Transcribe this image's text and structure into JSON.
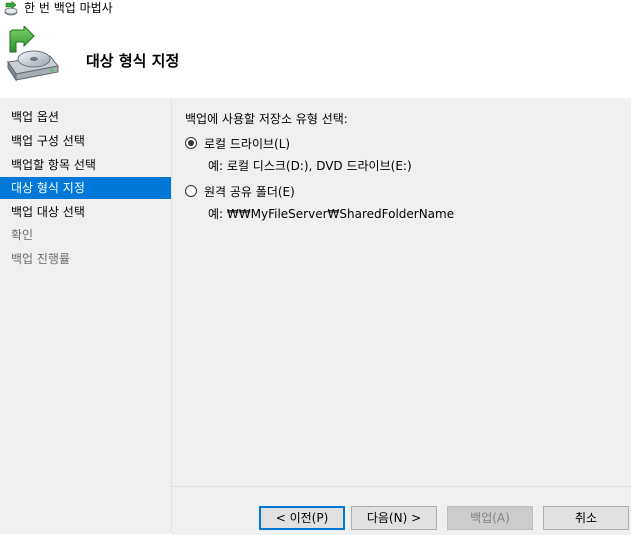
{
  "window": {
    "title": "한 번 백업 마법사"
  },
  "header": {
    "title": "대상 형식 지정"
  },
  "nav": {
    "items": [
      {
        "label": "백업 옵션",
        "state": "normal"
      },
      {
        "label": "백업 구성 선택",
        "state": "normal"
      },
      {
        "label": "백업할 항목 선택",
        "state": "normal"
      },
      {
        "label": "대상 형식 지정",
        "state": "selected"
      },
      {
        "label": "백업 대상 선택",
        "state": "normal"
      },
      {
        "label": "확인",
        "state": "disabled"
      },
      {
        "label": "백업 진행률",
        "state": "disabled"
      }
    ]
  },
  "main": {
    "prompt": "백업에 사용할 저장소 유형 선택:",
    "options": [
      {
        "label": "로컬 드라이브(L)",
        "example": "예: 로컬 디스크(D:), DVD 드라이브(E:)",
        "checked": true
      },
      {
        "label": "원격 공유 폴더(E)",
        "example": "예: ₩₩MyFileServer₩SharedFolderName",
        "checked": false
      }
    ]
  },
  "footer": {
    "prev_label": "< 이전(P)",
    "next_label": "다음(N) >",
    "backup_label": "백업(A)",
    "cancel_label": "취소"
  },
  "colors": {
    "selection": "#0078d7",
    "panel": "#f0f0f0"
  }
}
